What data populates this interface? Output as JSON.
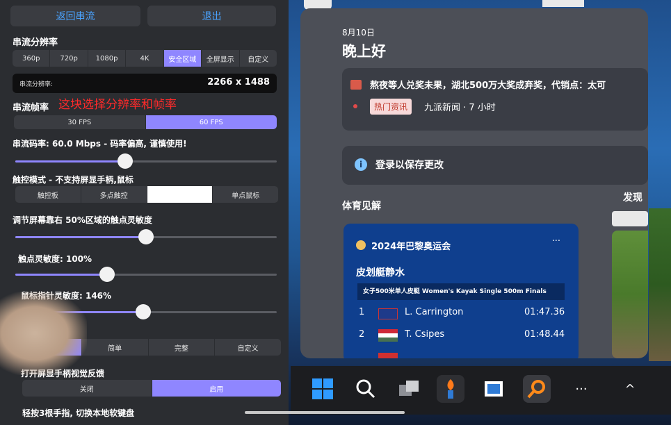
{
  "left_panel": {
    "back_button": "返回串流",
    "exit_button": "退出",
    "resolution_title": "串流分辨率",
    "resolution_options": [
      "360p",
      "720p",
      "1080p",
      "4K",
      "安全区域",
      "全屏显示",
      "自定义"
    ],
    "resolution_selected": "安全区域",
    "resolution_label": "串流分辨率:",
    "resolution_value": "2266 x 1488",
    "fps_title": "串流帧率",
    "annotation": "这块选择分辨率和帧率",
    "fps_options": [
      "30 FPS",
      "60 FPS"
    ],
    "fps_selected": "60 FPS",
    "bitrate_text": "串流码率: 60.0 Mbps - 码率偏高, 谨慎使用!",
    "bitrate_level": 0.42,
    "touch_mode_title": "触控模式 - 不支持屏显手柄,鼠标",
    "touch_mode_options": [
      "触控板",
      "多点触控",
      "",
      "单点鼠标"
    ],
    "touch_region_title": "调节屏幕靠右 50%区域的触点灵敏度",
    "touch_region_level": 0.5,
    "touch_sensitivity_title": "触点灵敏度: 100%",
    "touch_sensitivity_level": 0.35,
    "mouse_sensitivity_title": "鼠标指针灵敏度: 146%",
    "mouse_sensitivity_level": 0.49,
    "layout_options": [
      "",
      "简单",
      "完整",
      "自定义"
    ],
    "feedback_title": "打开屏显手柄视觉反馈",
    "feedback_options": [
      "关闭",
      "启用"
    ],
    "feedback_selected": "启用",
    "gesture_title": "轻按3根手指, 切换本地软键盘"
  },
  "widgets": {
    "date": "8月10日",
    "greeting": "晚上好",
    "news_headline": "熬夜等人兑奖未果，湖北500万大奖成弃奖，代销点：太可",
    "news_tag": "热门资讯",
    "news_source": "九派新闻 · 7 小时",
    "login_text": "登录以保存更改",
    "sports_title": "体育见解",
    "discover_title": "发现",
    "olympics": {
      "title": "2024年巴黎奥运会",
      "event": "皮划艇静水",
      "subtitle": "女子500米单人皮艇  Women's Kayak Single 500m Finals",
      "more": "···",
      "results": [
        {
          "rank": "1",
          "name": "L. Carrington",
          "time": "01:47.36"
        },
        {
          "rank": "2",
          "name": "T. Csipes",
          "time": "01:48.44"
        }
      ]
    }
  },
  "colors": {
    "accent": "#8f86ff",
    "link": "#4aa3ff",
    "annotation": "#ff2a2a"
  },
  "taskbar": {
    "icons": [
      "windows-start-icon",
      "search-icon",
      "task-view-icon",
      "torch-app-icon",
      "store-icon",
      "magnifier-app-icon",
      "more-icon",
      "chevron-up-icon"
    ],
    "more_glyph": "···",
    "chevron_glyph": "^"
  }
}
